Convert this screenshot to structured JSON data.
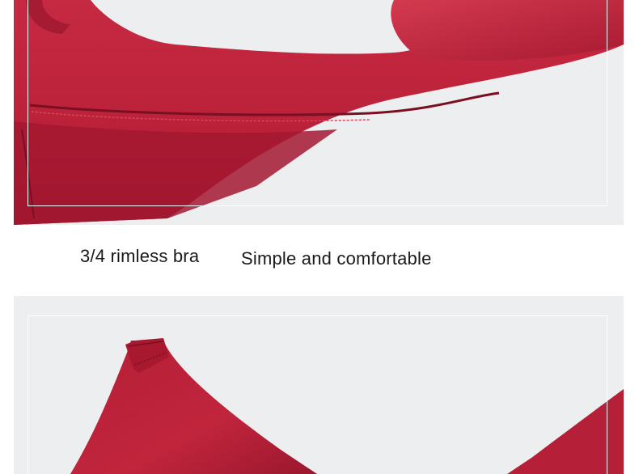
{
  "captions": {
    "left": "3/4 rimless bra",
    "right": "Simple and comfortable"
  },
  "colors": {
    "fabric": "#c0253c",
    "fabric_shadow": "#8e1428",
    "background": "#eceef0"
  }
}
